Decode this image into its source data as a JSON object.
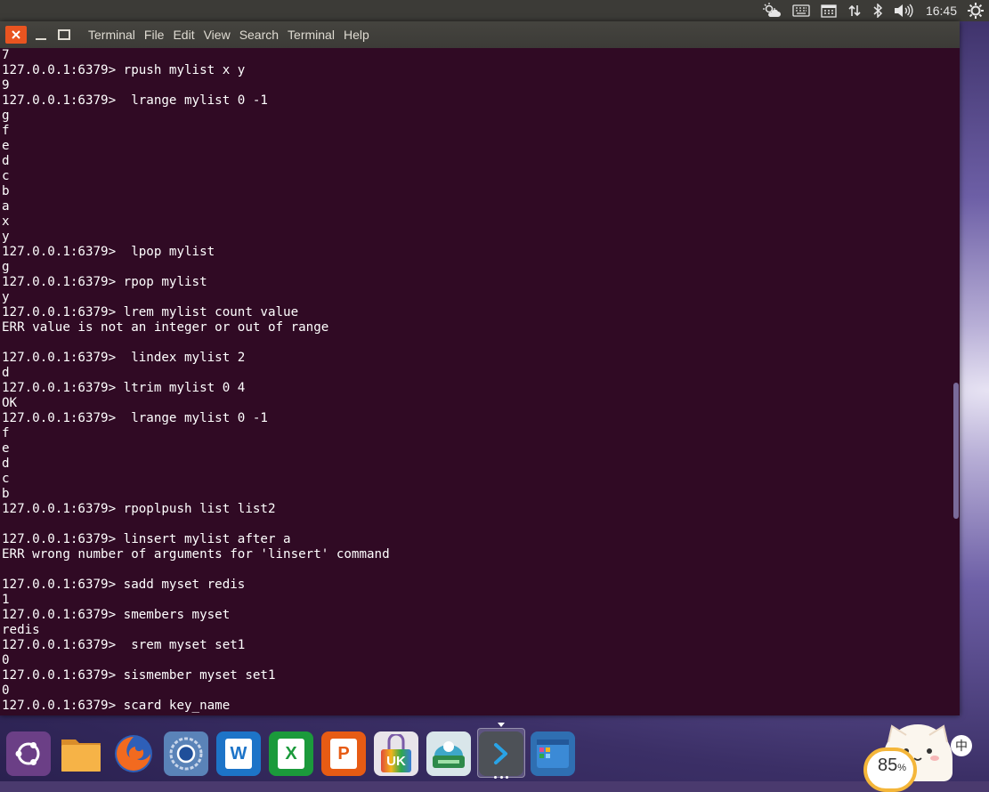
{
  "top_panel": {
    "clock": "16:45",
    "tray_icons": [
      "weather-icon",
      "keyboard-icon",
      "calendar-icon",
      "network-icon",
      "bluetooth-icon",
      "volume-icon",
      "settings-gear-icon"
    ]
  },
  "terminal": {
    "title": "Terminal",
    "menu": [
      "File",
      "Edit",
      "View",
      "Search",
      "Terminal",
      "Help"
    ],
    "lines": [
      "7",
      "127.0.0.1:6379> rpush mylist x y",
      "9",
      "127.0.0.1:6379>  lrange mylist 0 -1",
      "g",
      "f",
      "e",
      "d",
      "c",
      "b",
      "a",
      "x",
      "y",
      "127.0.0.1:6379>  lpop mylist",
      "g",
      "127.0.0.1:6379> rpop mylist",
      "y",
      "127.0.0.1:6379> lrem mylist count value",
      "ERR value is not an integer or out of range",
      "",
      "127.0.0.1:6379>  lindex mylist 2",
      "d",
      "127.0.0.1:6379> ltrim mylist 0 4",
      "OK",
      "127.0.0.1:6379>  lrange mylist 0 -1",
      "f",
      "e",
      "d",
      "c",
      "b",
      "127.0.0.1:6379> rpoplpush list list2",
      "",
      "127.0.0.1:6379> linsert mylist after a",
      "ERR wrong number of arguments for 'linsert' command",
      "",
      "127.0.0.1:6379> sadd myset redis",
      "1",
      "127.0.0.1:6379> smembers myset",
      "redis",
      "127.0.0.1:6379>  srem myset set1",
      "0",
      "127.0.0.1:6379> sismember myset set1",
      "0",
      "127.0.0.1:6379> scard key_name"
    ]
  },
  "dock": {
    "items": [
      {
        "name": "ubuntu-dash-icon"
      },
      {
        "name": "files-folder-icon"
      },
      {
        "name": "firefox-icon"
      },
      {
        "name": "chromium-icon"
      },
      {
        "name": "wps-writer-icon",
        "label": "W"
      },
      {
        "name": "wps-spreadsheet-icon",
        "label": "X"
      },
      {
        "name": "wps-presentation-icon",
        "label": "P"
      },
      {
        "name": "ubuntu-software-center-icon",
        "label": "UK"
      },
      {
        "name": "disk-utility-icon"
      },
      {
        "name": "terminal-app-icon"
      },
      {
        "name": "workspace-switcher-icon"
      }
    ]
  },
  "battery_widget": {
    "percent": "85",
    "unit": "%",
    "ime": "中"
  }
}
